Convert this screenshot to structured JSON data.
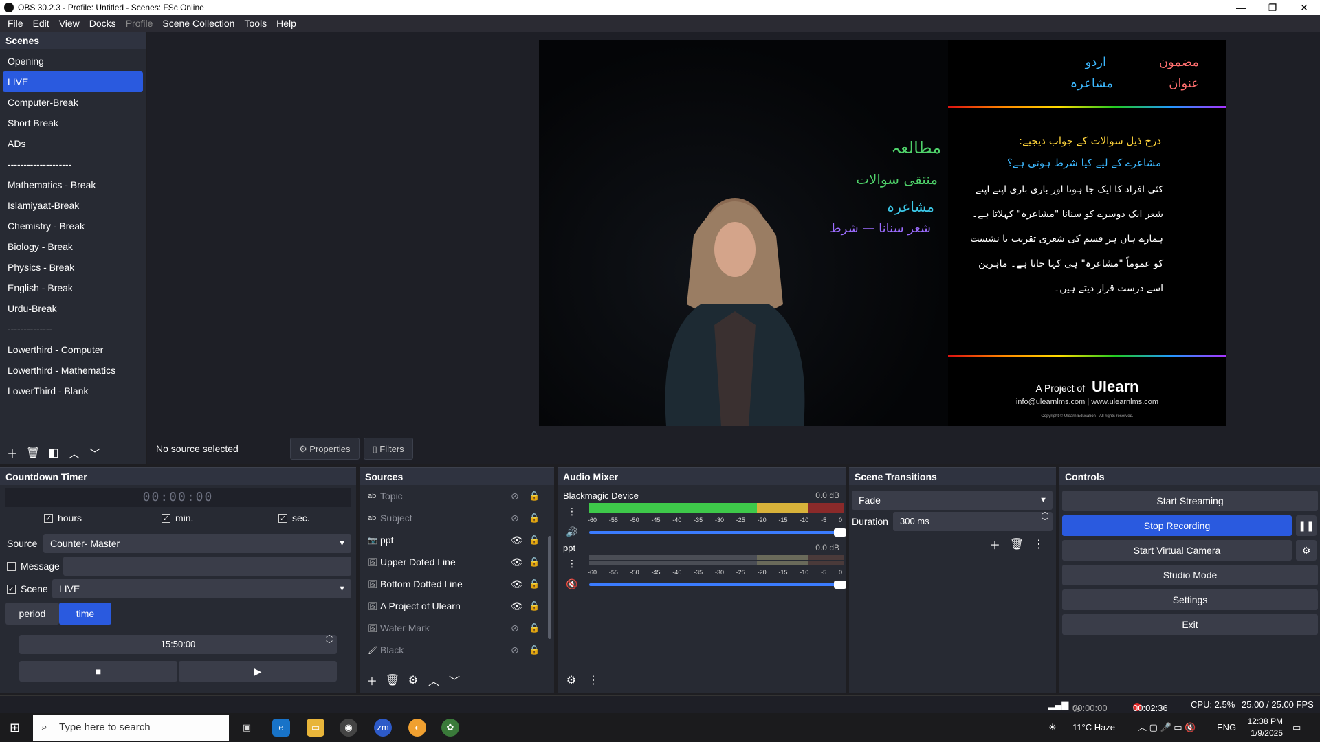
{
  "window": {
    "title": "OBS 30.2.3 - Profile: Untitled - Scenes: FSc Online",
    "minimize": "—",
    "maximize": "❐",
    "close": "✕"
  },
  "menu": [
    "File",
    "Edit",
    "View",
    "Docks",
    "Profile",
    "Scene Collection",
    "Tools",
    "Help"
  ],
  "scenes": {
    "title": "Scenes",
    "items": [
      "Opening",
      "LIVE",
      "Computer-Break",
      "Short Break",
      "ADs",
      "--------------------",
      "Mathematics  - Break",
      "Islamiyaat-Break",
      "Chemistry  - Break",
      "Biology  - Break",
      "Physics  - Break",
      "English - Break",
      "Urdu-Break",
      "--------------",
      "Lowerthird - Computer",
      "Lowerthird - Mathematics",
      "LowerThird - Blank"
    ],
    "active_index": 1
  },
  "preview": {
    "subject_label": "مضمون",
    "subject_value": "اردو",
    "topic_label": "عنوان",
    "topic_value": "مشاعرہ",
    "heading": "درج ذیل سوالات کے جواب دیجیے:",
    "question": "مشاعرے کے لیے کیا شرط ہوتی ہے؟",
    "body": "کئی افراد کا ایک جا ہونا اور باری باری اپنے اپنے شعر ایک دوسرے کو سنانا \"مشاعرہ\" کہلاتا ہے۔ ہمارے ہاں ہر قسم کی شعری تقریب یا نشست کو عموماً \"مشاعرہ\" ہی کہا جاتا ہے۔ ماہرین اسے درست قرار دیتے ہیں۔",
    "notes": [
      "مطالعہ",
      "منتقی سوالات",
      "مشاعرہ",
      "شعر سنانا — شرط"
    ],
    "footer_project": "A Project of",
    "footer_brand": "Ulearn",
    "footer_contact": "info@ulearnlms.com | www.ulearnlms.com",
    "footer_copyright": "Copyright © Ulearn Education - All rights reserved."
  },
  "source_bar": {
    "status": "No source selected",
    "properties": "Properties",
    "filters": "Filters"
  },
  "countdown": {
    "title": "Countdown Timer",
    "display": "00:00:00",
    "hours": "hours",
    "min": "min.",
    "sec": "sec.",
    "source_label": "Source",
    "source_value": "Counter- Master",
    "message_label": "Message",
    "scene_label": "Scene",
    "scene_value": "LIVE",
    "period": "period",
    "time": "time",
    "time_value": "15:50:00"
  },
  "sources": {
    "title": "Sources",
    "items": [
      {
        "name": "Topic",
        "icon": "ab",
        "visible": false
      },
      {
        "name": "Subject",
        "icon": "ab",
        "visible": false
      },
      {
        "name": "ppt",
        "icon": "📷",
        "visible": true
      },
      {
        "name": "Upper Doted Line",
        "icon": "🖼",
        "visible": true
      },
      {
        "name": "Bottom Dotted Line",
        "icon": "🖼",
        "visible": true
      },
      {
        "name": "A Project of Ulearn",
        "icon": "🖼",
        "visible": true
      },
      {
        "name": "Water Mark",
        "icon": "🖼",
        "visible": false
      },
      {
        "name": "Black",
        "icon": "🖌",
        "visible": false
      }
    ]
  },
  "mixer": {
    "title": "Audio Mixer",
    "channels": [
      {
        "name": "Blackmagic Device",
        "db": "0.0 dB",
        "muted": false
      },
      {
        "name": "ppt",
        "db": "0.0 dB",
        "muted": true
      }
    ],
    "ticks": [
      "-60",
      "-55",
      "-50",
      "-45",
      "-40",
      "-35",
      "-30",
      "-25",
      "-20",
      "-15",
      "-10",
      "-5",
      "0"
    ]
  },
  "transitions": {
    "title": "Scene Transitions",
    "type": "Fade",
    "duration_label": "Duration",
    "duration_value": "300 ms"
  },
  "controls": {
    "title": "Controls",
    "start_streaming": "Start Streaming",
    "stop_recording": "Stop Recording",
    "start_virtual_camera": "Start Virtual Camera",
    "studio_mode": "Studio Mode",
    "settings": "Settings",
    "exit": "Exit"
  },
  "status": {
    "stream_time": "00:00:00",
    "rec_time": "00:02:36",
    "cpu": "CPU: 2.5%",
    "fps": "25.00 / 25.00 FPS"
  },
  "taskbar": {
    "search_placeholder": "Type here to search",
    "weather": "11°C  Haze",
    "lang": "ENG",
    "time": "12:38 PM",
    "date": "1/9/2025"
  },
  "colors": {
    "accent": "#2a5adf",
    "record": "#e02828",
    "panel": "#272a33"
  }
}
